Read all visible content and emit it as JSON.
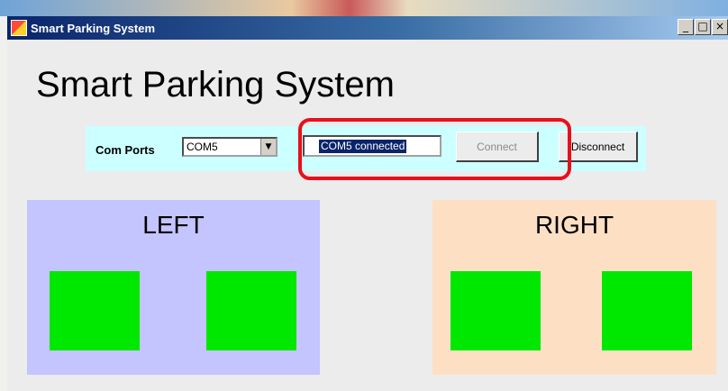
{
  "window": {
    "title": "Smart Parking System",
    "controls": {
      "minimize": "_",
      "maximize": "□",
      "close": "×"
    }
  },
  "main": {
    "heading": "Smart Parking System"
  },
  "toolbar": {
    "com_ports_label": "Com Ports",
    "com_port_selected": "COM5",
    "status_text": "COM5 connected",
    "connect_label": "Connect",
    "disconnect_label": "Disconnect"
  },
  "zones": {
    "left": {
      "label": "LEFT",
      "slots": [
        "occupied-free",
        "occupied-free"
      ]
    },
    "right": {
      "label": "RIGHT",
      "slots": [
        "occupied-free",
        "occupied-free"
      ]
    }
  },
  "colors": {
    "toolbar_bg": "#ccffff",
    "left_zone_bg": "#c4c4ff",
    "right_zone_bg": "#fde0c4",
    "slot_color": "#00e800",
    "highlight_annotation": "#e8101a"
  }
}
